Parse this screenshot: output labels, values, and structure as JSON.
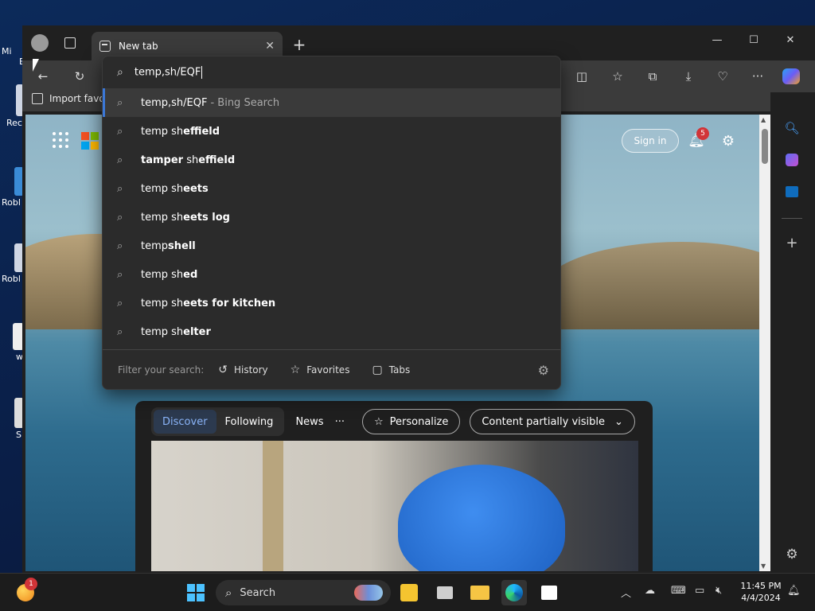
{
  "desktop": {
    "icons": [
      {
        "label": "Mi"
      },
      {
        "label": "E"
      },
      {
        "label": "Rec"
      },
      {
        "label": "Robl"
      },
      {
        "label": "Robl"
      },
      {
        "label": "w"
      },
      {
        "label": "Sl"
      }
    ]
  },
  "browser": {
    "tab_title": "New tab",
    "favorites_import": "Import favo"
  },
  "omnibox": {
    "query": "temp,sh/EQF",
    "top_suggestion": {
      "text": "temp,sh/EQF",
      "hint": "- Bing Search"
    },
    "suggestions": [
      {
        "prefix": "temp sh",
        "bold": "effield"
      },
      {
        "prefix": "",
        "bold": "tamper",
        "rest_prefix": " sh",
        "rest_bold": "effield"
      },
      {
        "prefix": "temp sh",
        "bold": "eets"
      },
      {
        "prefix": "temp sh",
        "bold": "eets log"
      },
      {
        "prefix": "temp",
        "bold": "shell"
      },
      {
        "prefix": "temp sh",
        "bold": "ed"
      },
      {
        "prefix": "temp sh",
        "bold": "eets for kitchen"
      },
      {
        "prefix": "temp sh",
        "bold": "elter"
      }
    ],
    "filter_label": "Filter your search:",
    "filters": [
      "History",
      "Favorites",
      "Tabs"
    ]
  },
  "newtab": {
    "signin": "Sign in",
    "notif_count": "5",
    "feed_tabs": [
      "Discover",
      "Following"
    ],
    "feed_news": "News",
    "feed_more": "···",
    "personalize": "Personalize",
    "content_visibility": "Content partially visible"
  },
  "taskbar": {
    "search_label": "Search",
    "time": "11:45 PM",
    "date": "4/4/2024",
    "widget_badge": "1"
  },
  "colors": {
    "accent": "#3b78d8",
    "dropdown_bg": "#2b2b2b",
    "badge": "#d13438"
  }
}
